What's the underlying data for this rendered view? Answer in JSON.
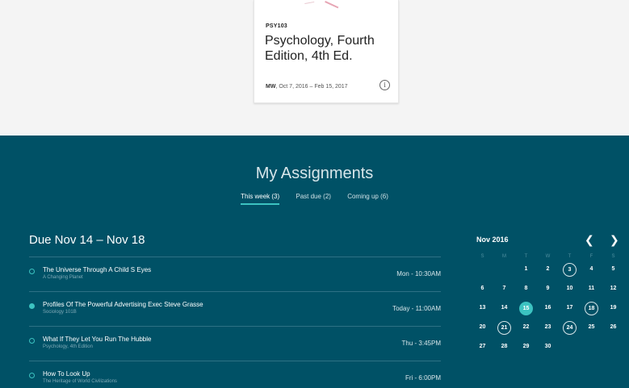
{
  "course_card": {
    "code": "PSY103",
    "title": "Psychology, Fourth Edition, 4th Ed.",
    "schedule_days": "MW",
    "schedule_range": ", Oct 7, 2016 – Feb 15, 2017",
    "info_icon": "ⓘ"
  },
  "assignments": {
    "heading": "My Assignments",
    "tabs": [
      {
        "label": "This week (3)",
        "active": true
      },
      {
        "label": "Past due (2)",
        "active": false
      },
      {
        "label": "Coming up (6)",
        "active": false
      }
    ],
    "due_range": "Due Nov 14 – Nov 18",
    "items": [
      {
        "name": "The Universe Through A Child S Eyes",
        "sub": "A Changing Planet",
        "time": "Mon - 10:30AM",
        "status": "open"
      },
      {
        "name": "Profiles Of The Powerful Advertising Exec Steve Grasse",
        "sub": "Sociology 101B",
        "time": "Today - 11:00AM",
        "status": "filled"
      },
      {
        "name": "What If They Let You Run The Hubble",
        "sub": "Psychology, 4th Edition",
        "time": "Thu - 3:45PM",
        "status": "open"
      },
      {
        "name": "How To Look Up",
        "sub": "The Heritage of World Civilizations",
        "time": "Fri - 6:00PM",
        "status": "open"
      }
    ]
  },
  "calendar": {
    "month": "Nov 2016",
    "prev_icon": "‹",
    "next_icon": "›",
    "weekdays": [
      "S",
      "M",
      "T",
      "W",
      "T",
      "F",
      "S"
    ],
    "weeks": [
      [
        "",
        "",
        "1",
        "2",
        "3",
        "4",
        "5"
      ],
      [
        "6",
        "7",
        "8",
        "9",
        "10",
        "11",
        "12"
      ],
      [
        "13",
        "14",
        "15",
        "16",
        "17",
        "18",
        "19"
      ],
      [
        "20",
        "21",
        "22",
        "23",
        "24",
        "25",
        "26"
      ],
      [
        "27",
        "28",
        "29",
        "30",
        "",
        "",
        ""
      ]
    ],
    "today": "15",
    "ringed": [
      "3",
      "18",
      "21",
      "24"
    ]
  },
  "colors": {
    "panel_bg": "#005166",
    "accent": "#3cc3c1",
    "page_bg": "#f4f4f4"
  }
}
